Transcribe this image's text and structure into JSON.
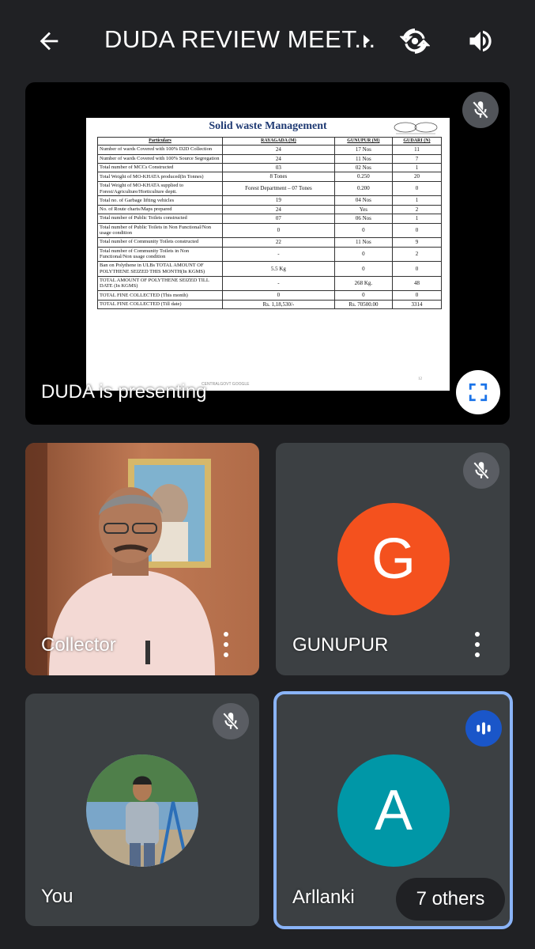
{
  "header": {
    "title": "DUDA REVIEW MEET...",
    "icons": [
      "back-arrow-icon",
      "chevron-right-icon",
      "switch-camera-icon",
      "speaker-icon"
    ]
  },
  "presentation": {
    "presenting_label": "DUDA is presenting",
    "slide": {
      "title": "Solid waste Management",
      "columns": [
        "Particulars",
        "RAYAGADA (M)",
        "GUNUPUR (M)",
        "GUDARI (N)"
      ],
      "rows": [
        [
          "Number of wards Covered with 100% D2D Collection",
          "24",
          "17 Nos",
          "11"
        ],
        [
          "Number of wards Covered with 100% Source Segregation",
          "24",
          "11 Nos",
          "7"
        ],
        [
          "Total number of MCCs Constructed",
          "03",
          "02 Nos",
          "1"
        ],
        [
          "Total Weight of MO-KHATA produced(In Tonnes)",
          "8 Tones",
          "0.250",
          "20"
        ],
        [
          "Total Weight of MO-KHATA supplied to Forest/Agriculture/Horticulture deptt.",
          "Forest Department – 07 Tones",
          "0.200",
          "0"
        ],
        [
          "Total no. of Garbage lifting vehicles",
          "19",
          "04 Nos",
          "1"
        ],
        [
          "No. of Route charts/Maps prepared",
          "24",
          "Yes",
          "2"
        ],
        [
          "Total number of Public Toilets constructed",
          "07",
          "06 Nos",
          "1"
        ],
        [
          "Total number of Public Toilets in Non Functional/Non usage condition",
          "0",
          "0",
          "0"
        ],
        [
          "Total number of Community Toilets constructed",
          "22",
          "11 Nos",
          "9"
        ],
        [
          "Total number of Community Toilets in Non Functional/Non usage condition",
          "-",
          "0",
          "2"
        ],
        [
          "Ban on Polythene in ULBs TOTAL AMOUNT OF POLYTHENE SEIZED THIS MONTH(In KGMS)",
          "5.5 Kg",
          "0",
          "0"
        ],
        [
          "TOTAL AMOUNT OF POLYTHENE SEIZED TILL DATE (In KGMS)",
          "-",
          "268 Kg.",
          "48"
        ],
        [
          "TOTAL FINE COLLECTED (This month)",
          "0",
          "0",
          "0"
        ],
        [
          "TOTAL FINE COLLECTED (Till date)",
          "Rs. 1,18,530/-",
          "Rs. 70500.00",
          "3314"
        ]
      ],
      "footer": "CENTRALGOVT GOOGLE",
      "page_number": "12"
    }
  },
  "participants": {
    "collector": {
      "name": "Collector"
    },
    "gunupur": {
      "name": "GUNUPUR",
      "initial": "G",
      "avatar_color": "#f4511e"
    },
    "you": {
      "name": "You"
    },
    "arllanki": {
      "name": "Arllanki",
      "initial": "A",
      "avatar_color": "#0097a7",
      "others_label": "7 others"
    }
  },
  "colors": {
    "background": "#202124",
    "tile": "#3c4043",
    "active_speaker_border": "#8ab4f8",
    "speaking_badge": "#1a56c9"
  }
}
